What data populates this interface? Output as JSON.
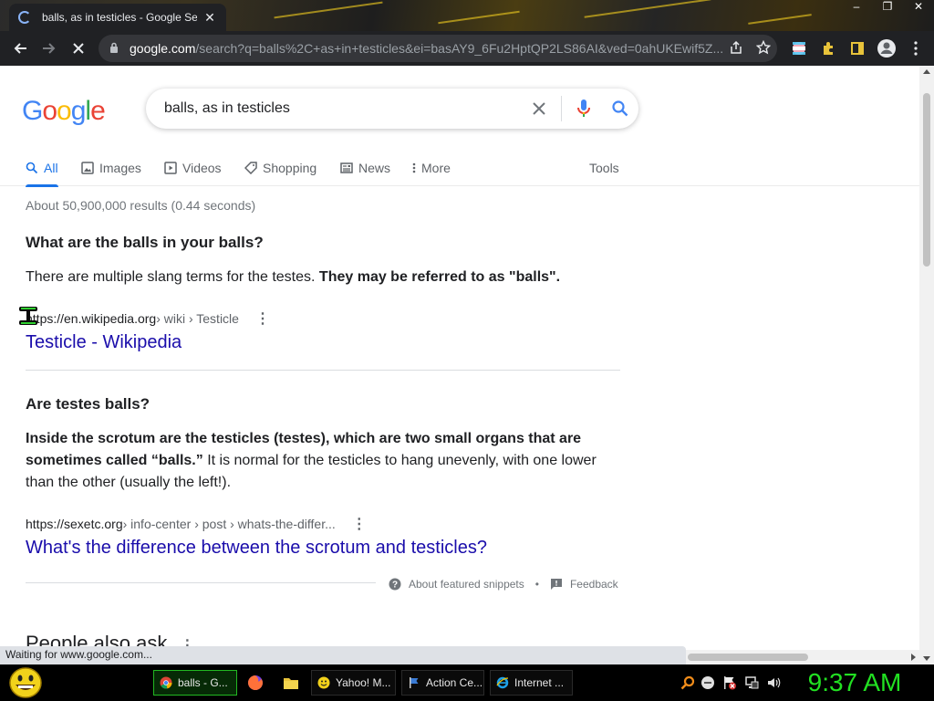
{
  "browser": {
    "tab_title": "balls, as in testicles - Google Search",
    "url_host": "google.com",
    "url_rest": "/search?q=balls%2C+as+in+testicles&ei=basAY9_6Fu2HptQP2LS86AI&ved=0ahUKEwif5Z...",
    "status_text": "Waiting for www.google.com..."
  },
  "google": {
    "logo": [
      "G",
      "o",
      "o",
      "g",
      "l",
      "e"
    ],
    "logo_colors": [
      "#4285f4",
      "#ea4335",
      "#fbbc05",
      "#4285f4",
      "#34a853",
      "#ea4335"
    ],
    "query": "balls, as in testicles",
    "tabs": [
      {
        "label": "All",
        "icon": "search-icon",
        "active": true
      },
      {
        "label": "Images",
        "icon": "image-icon",
        "active": false
      },
      {
        "label": "Videos",
        "icon": "play-icon",
        "active": false
      },
      {
        "label": "Shopping",
        "icon": "tag-icon",
        "active": false
      },
      {
        "label": "News",
        "icon": "newspaper-icon",
        "active": false
      },
      {
        "label": "More",
        "icon": "more-vert-icon",
        "active": false
      }
    ],
    "tools_label": "Tools",
    "stats": "About 50,900,000 results (0.44 seconds)",
    "snippet1": {
      "question": "What are the balls in your balls?",
      "text_plain": "There are multiple slang terms for the testes. ",
      "text_bold": "They may be referred to as \"balls\".",
      "cite_host": "https://en.wikipedia.org",
      "cite_path": " › wiki › Testicle",
      "link": "Testicle - Wikipedia"
    },
    "snippet2": {
      "question": "Are testes balls?",
      "text_bold": "Inside the scrotum are the testicles (testes), which are two small organs that are sometimes called “balls.”",
      "text_plain": " It is normal for the testicles to hang unevenly, with one lower than the other (usually the left!).",
      "cite_host": "https://sexetc.org",
      "cite_path": " › info-center › post › whats-the-differ...",
      "link": "What's the difference between the scrotum and testicles?"
    },
    "about_snippets": "About featured snippets",
    "feedback": "Feedback",
    "people_also_ask": "People also ask"
  },
  "taskbar": {
    "items": [
      {
        "label": "balls - G...",
        "icon": "chrome-icon",
        "active": true
      },
      {
        "label": "Yahoo! M...",
        "icon": "yahoo-messenger-icon",
        "active": false
      },
      {
        "label": "Action Ce...",
        "icon": "flag-icon",
        "active": false
      },
      {
        "label": "Internet ...",
        "icon": "ie-icon",
        "active": false
      }
    ],
    "clock": "9:37 AM"
  },
  "colors": {
    "link": "#1a0dab",
    "accent": "#1a73e8",
    "clock": "#22e022"
  }
}
